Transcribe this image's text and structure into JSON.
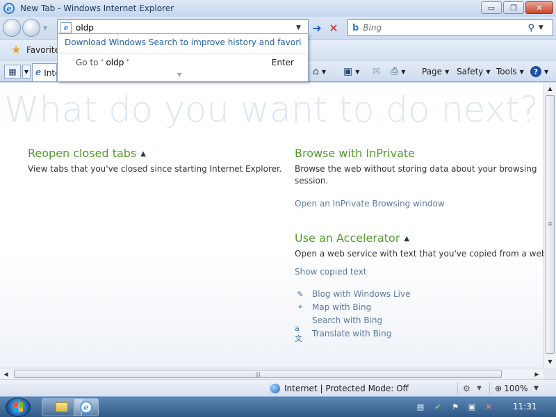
{
  "window": {
    "title": "New Tab - Windows Internet Explorer",
    "minimize": "▭",
    "restore": "❐",
    "close": "✕"
  },
  "address_bar": {
    "value": "oldp",
    "go_icon": "arrow-right-icon",
    "stop_icon": "x-icon"
  },
  "search_bar": {
    "placeholder": "Bing",
    "provider_icon": "bing-icon"
  },
  "favorites": {
    "label": "Favorites"
  },
  "tab": {
    "label": "Internet Explorer"
  },
  "command_bar": {
    "page_label": "Page",
    "safety_label": "Safety",
    "tools_label": "Tools",
    "help_symbol": "?"
  },
  "autocomplete": {
    "windows_search_link": "Download Windows Search to improve history and favorites r...",
    "goto_prefix": "Go to '",
    "goto_value": "oldp",
    "goto_suffix": "'",
    "enter_label": "Enter"
  },
  "content": {
    "headline": "What do you want to do next?",
    "reopen": {
      "title": "Reopen closed tabs",
      "desc": "View tabs that you've closed since starting Internet Explorer."
    },
    "inprivate": {
      "title": "Browse with InPrivate",
      "desc": "Browse the web without storing data about your browsing session.",
      "link": "Open an InPrivate Browsing window"
    },
    "accelerator": {
      "title": "Use an Accelerator",
      "desc": "Open a web service with text that you've copied from a webp",
      "show_link": "Show copied text",
      "items": [
        {
          "label": "Blog with Windows Live",
          "icon": "blog-icon"
        },
        {
          "label": "Map with Bing",
          "icon": "map-icon"
        },
        {
          "label": "Search with Bing",
          "icon": ""
        },
        {
          "label": "Translate with Bing",
          "icon": "translate-icon"
        }
      ]
    }
  },
  "status_bar": {
    "zone": "Internet | Protected Mode: Off",
    "zoom": "100%"
  },
  "taskbar": {
    "clock": "11:31"
  },
  "colors": {
    "accent_green": "#4f9a2b",
    "link_blue": "#5a7aa0"
  }
}
